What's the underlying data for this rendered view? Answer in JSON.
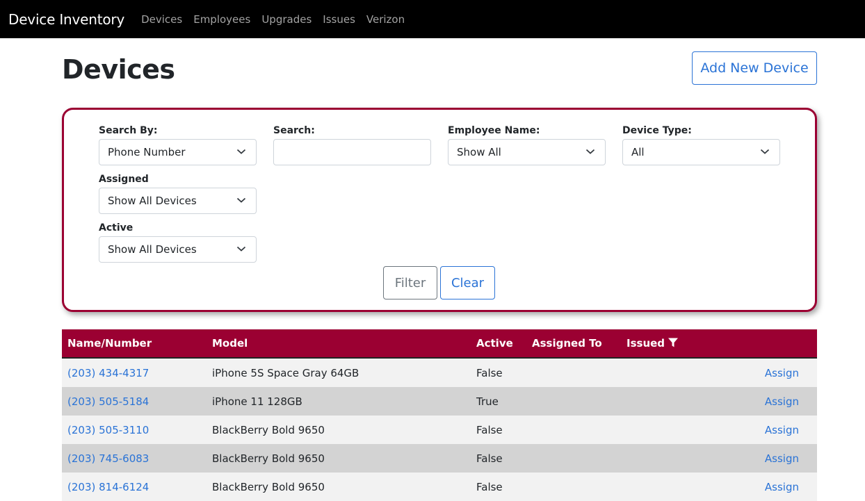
{
  "nav": {
    "brand": "Device Inventory",
    "links": [
      "Devices",
      "Employees",
      "Upgrades",
      "Issues",
      "Verizon"
    ]
  },
  "header": {
    "title": "Devices",
    "add_button": "Add New Device"
  },
  "filters": {
    "search_by": {
      "label": "Search By:",
      "value": "Phone Number"
    },
    "search": {
      "label": "Search:",
      "value": ""
    },
    "employee_name": {
      "label": "Employee Name:",
      "value": "Show All"
    },
    "device_type": {
      "label": "Device Type:",
      "value": "All"
    },
    "assigned": {
      "label": "Assigned",
      "value": "Show All Devices"
    },
    "active": {
      "label": "Active",
      "value": "Show All Devices"
    },
    "filter_button": "Filter",
    "clear_button": "Clear"
  },
  "table": {
    "headers": [
      "Name/Number",
      "Model",
      "Active",
      "Assigned To",
      "Issued"
    ],
    "rows": [
      {
        "number": "(203) 434-4317",
        "model": "iPhone 5S Space Gray 64GB",
        "active": "False",
        "assigned_to": "",
        "issued": "",
        "action": "Assign"
      },
      {
        "number": "(203) 505-5184",
        "model": "iPhone 11 128GB",
        "active": "True",
        "assigned_to": "",
        "issued": "",
        "action": "Assign"
      },
      {
        "number": "(203) 505-3110",
        "model": "BlackBerry Bold 9650",
        "active": "False",
        "assigned_to": "",
        "issued": "",
        "action": "Assign"
      },
      {
        "number": "(203) 745-6083",
        "model": "BlackBerry Bold 9650",
        "active": "False",
        "assigned_to": "",
        "issued": "",
        "action": "Assign"
      },
      {
        "number": "(203) 814-6124",
        "model": "BlackBerry Bold 9650",
        "active": "False",
        "assigned_to": "",
        "issued": "",
        "action": "Assign"
      }
    ]
  },
  "colors": {
    "navbar": "#000000",
    "accent": "#9b0032",
    "link": "#2a73d6"
  }
}
